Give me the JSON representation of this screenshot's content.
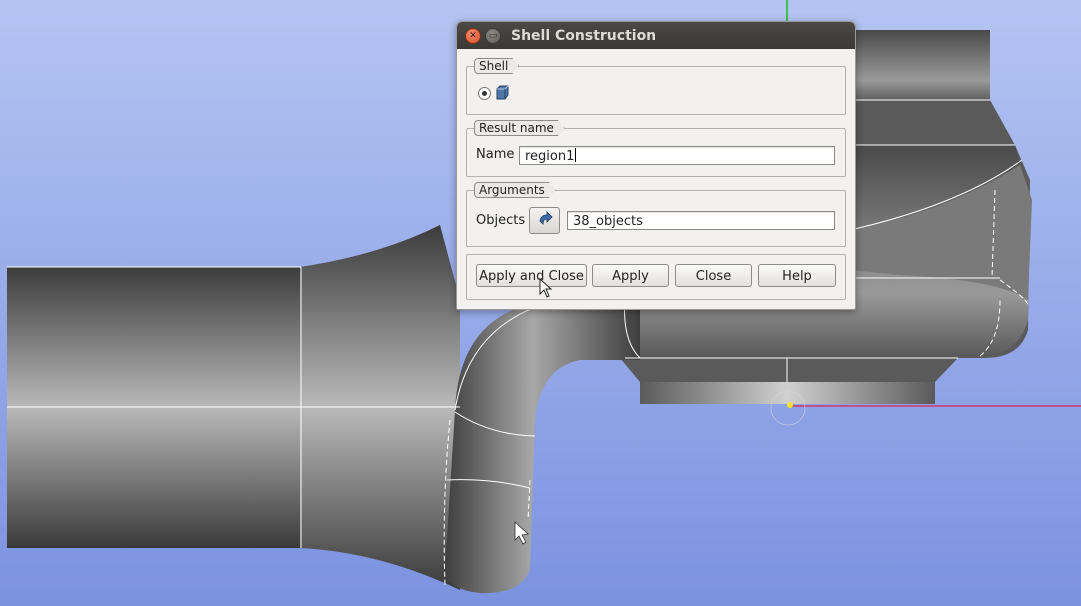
{
  "dialog": {
    "title": "Shell Construction",
    "shell_group": {
      "label": "Shell",
      "option_icon": "shell-cube-icon"
    },
    "result_group": {
      "label": "Result name",
      "name_label": "Name",
      "name_value": "region1"
    },
    "arguments_group": {
      "label": "Arguments",
      "objects_label": "Objects",
      "objects_value": "38_objects",
      "select_icon": "selection-arrow-icon"
    },
    "buttons": {
      "apply_and_close": "Apply and Close",
      "apply": "Apply",
      "close": "Close",
      "help": "Help"
    }
  },
  "colors": {
    "viewport_top": "#a8b9ee",
    "viewport_bottom": "#7d93e0",
    "model_dark": "#3a3a3a",
    "model_light": "#b8b8b8",
    "accent_axis_green": "#19c219",
    "accent_axis_red": "#e0205a",
    "title_bar": "#3c3b37"
  }
}
